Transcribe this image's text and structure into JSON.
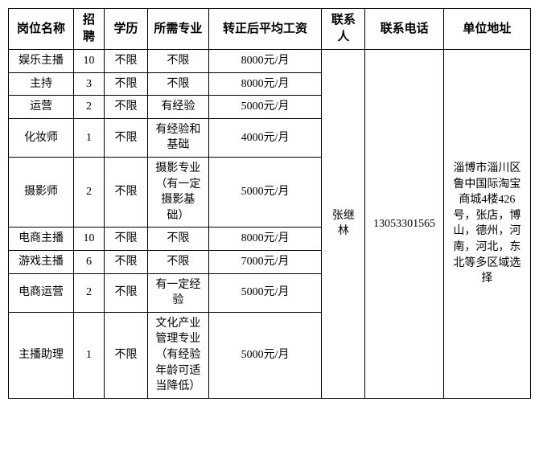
{
  "headers": {
    "position": "岗位名称",
    "count": "招聘",
    "education": "学历",
    "major": "所需专业",
    "salary": "转正后平均工资",
    "contact": "联系人",
    "phone": "联系电话",
    "address": "单位地址"
  },
  "rows": [
    {
      "position": "娱乐主播",
      "count": "10",
      "education": "不限",
      "major": "不限",
      "salary": "8000元/月"
    },
    {
      "position": "主持",
      "count": "3",
      "education": "不限",
      "major": "不限",
      "salary": "8000元/月"
    },
    {
      "position": "运营",
      "count": "2",
      "education": "不限",
      "major": "有经验",
      "salary": "5000元/月"
    },
    {
      "position": "化妆师",
      "count": "1",
      "education": "不限",
      "major": "有经验和基础",
      "salary": "4000元/月"
    },
    {
      "position": "摄影师",
      "count": "2",
      "education": "不限",
      "major": "摄影专业（有一定摄影基础）",
      "salary": "5000元/月"
    },
    {
      "position": "电商主播",
      "count": "10",
      "education": "不限",
      "major": "不限",
      "salary": "8000元/月"
    },
    {
      "position": "游戏主播",
      "count": "6",
      "education": "不限",
      "major": "不限",
      "salary": "7000元/月"
    },
    {
      "position": "电商运营",
      "count": "2",
      "education": "不限",
      "major": "有一定经验",
      "salary": "5000元/月"
    },
    {
      "position": "主播助理",
      "count": "1",
      "education": "不限",
      "major": "文化产业管理专业（有经验年龄可适当降低）",
      "salary": "5000元/月"
    }
  ],
  "contact": {
    "name": "张继林",
    "phone": "13053301565",
    "address": "淄博市淄川区鲁中国际淘宝商城4楼426号，张店，博山，德州，河南，河北，东北等多区域选择"
  }
}
